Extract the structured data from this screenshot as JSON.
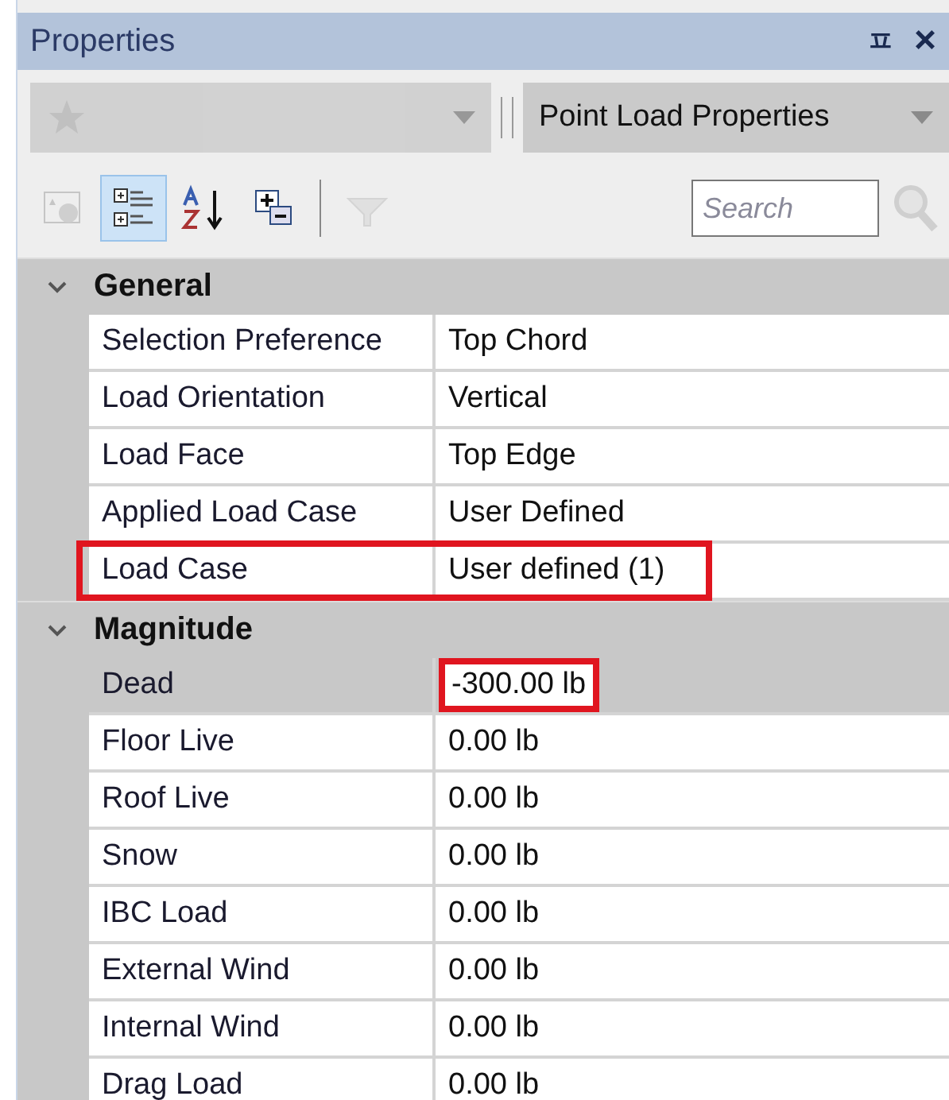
{
  "panel": {
    "title": "Properties",
    "pin_icon": "ㅍ",
    "close_icon": "×"
  },
  "selectors": {
    "left": {
      "disabled": true
    },
    "right": {
      "value": "Point Load Properties"
    }
  },
  "toolbar": [
    {
      "kind": "pages",
      "selected": false,
      "disabled": true
    },
    {
      "kind": "categorized",
      "selected": true,
      "disabled": false
    },
    {
      "kind": "alphabetical",
      "selected": false,
      "disabled": false
    },
    {
      "kind": "expand",
      "selected": false,
      "disabled": false
    },
    {
      "kind": "filter",
      "selected": false,
      "disabled": true
    }
  ],
  "search": {
    "placeholder": "Search"
  },
  "categories": [
    {
      "name": "General",
      "expanded": true,
      "rows": [
        {
          "name": "Selection Preference",
          "value": "Top Chord",
          "selected": false
        },
        {
          "name": "Load Orientation",
          "value": "Vertical",
          "selected": false
        },
        {
          "name": "Load Face",
          "value": "Top Edge",
          "selected": false
        },
        {
          "name": "Applied Load Case",
          "value": "User Defined",
          "selected": false
        },
        {
          "name": "Load Case",
          "value": "User defined (1)",
          "selected": false,
          "row_highlighted": true
        }
      ]
    },
    {
      "name": "Magnitude",
      "expanded": true,
      "rows": [
        {
          "name": "Dead",
          "value": "-300.00 lb",
          "selected": true,
          "value_highlighted": true
        },
        {
          "name": "Floor Live",
          "value": "0.00 lb",
          "selected": false
        },
        {
          "name": "Roof Live",
          "value": "0.00 lb",
          "selected": false
        },
        {
          "name": "Snow",
          "value": "0.00 lb",
          "selected": false
        },
        {
          "name": "IBC Load",
          "value": "0.00 lb",
          "selected": false
        },
        {
          "name": "External Wind",
          "value": "0.00 lb",
          "selected": false
        },
        {
          "name": "Internal Wind",
          "value": "0.00 lb",
          "selected": false
        },
        {
          "name": "Drag Load",
          "value": "0.00 lb",
          "selected": false
        }
      ]
    }
  ]
}
